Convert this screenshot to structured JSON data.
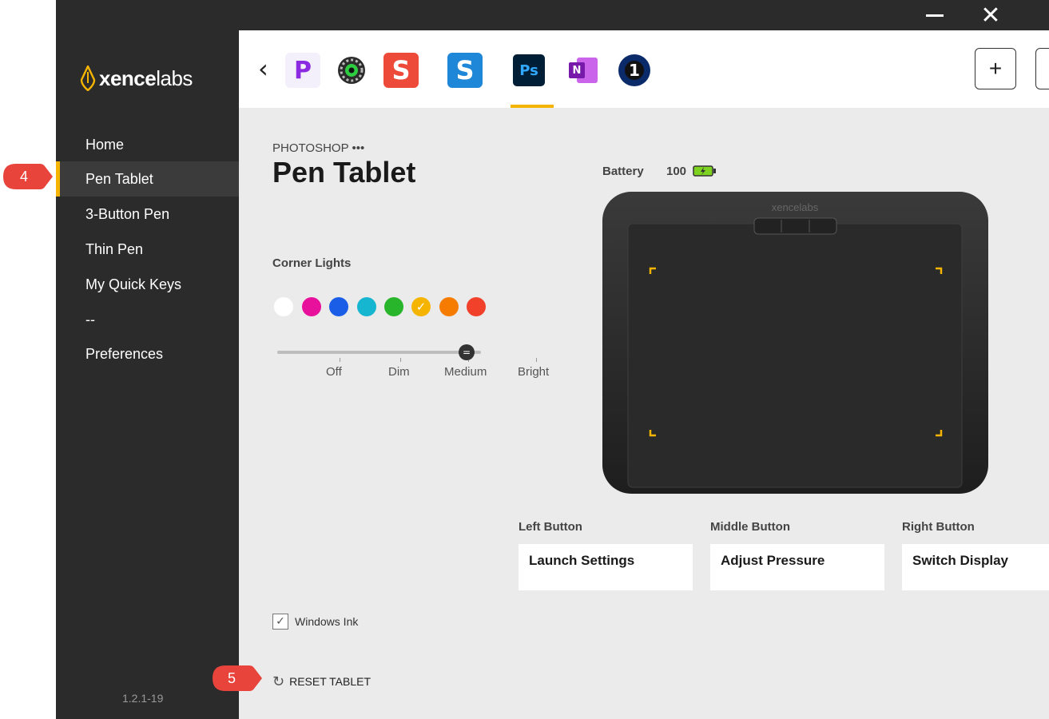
{
  "window": {
    "minimize_icon": "minimize-icon",
    "close_icon": "close-icon"
  },
  "sidebar": {
    "logo_bold": "xence",
    "logo_light": "labs",
    "items": [
      {
        "label": "Home",
        "active": false
      },
      {
        "label": "Pen Tablet",
        "active": true
      },
      {
        "label": "3-Button Pen",
        "active": false
      },
      {
        "label": "Thin Pen",
        "active": false
      },
      {
        "label": "My Quick Keys",
        "active": false
      },
      {
        "label": "--",
        "active": false
      },
      {
        "label": "Preferences",
        "active": false
      }
    ],
    "version": "1.2.1-19"
  },
  "app_bar": {
    "back_icon": "chevron-left-icon",
    "apps": [
      {
        "name": "purple-p-app",
        "letter": "P"
      },
      {
        "name": "gear-app",
        "letter": ""
      },
      {
        "name": "snagit-red",
        "letter": "S"
      },
      {
        "name": "snagit-blue",
        "letter": "S"
      },
      {
        "name": "photoshop",
        "letter": "Ps",
        "active": true
      },
      {
        "name": "onenote",
        "letter": "N"
      },
      {
        "name": "capture-one",
        "letter": "1"
      }
    ],
    "add_label": "+",
    "settings_icon": "gear-icon"
  },
  "content": {
    "app_name": "PHOTOSHOP •••",
    "title": "Pen Tablet",
    "battery_label": "Battery",
    "battery_value": "100",
    "corner_lights_label": "Corner Lights",
    "colors": [
      "#ffffff",
      "#e8119b",
      "#1a5de6",
      "#16b6d1",
      "#28b52b",
      "#f5b400",
      "#f57c00",
      "#f1412a"
    ],
    "selected_color_index": 5,
    "brightness_levels": [
      "Off",
      "Dim",
      "Medium",
      "Bright"
    ],
    "brightness": "Medium",
    "device_brand": "xencelabs",
    "buttons": [
      {
        "label": "Left Button",
        "value": "Launch Settings"
      },
      {
        "label": "Middle Button",
        "value": "Adjust Pressure"
      },
      {
        "label": "Right Button",
        "value": "Switch Display"
      }
    ],
    "windows_ink_label": "Windows Ink",
    "windows_ink_checked": true,
    "reset_label": "RESET TABLET"
  },
  "callouts": [
    "4",
    "5"
  ],
  "accent": "#f5b400"
}
